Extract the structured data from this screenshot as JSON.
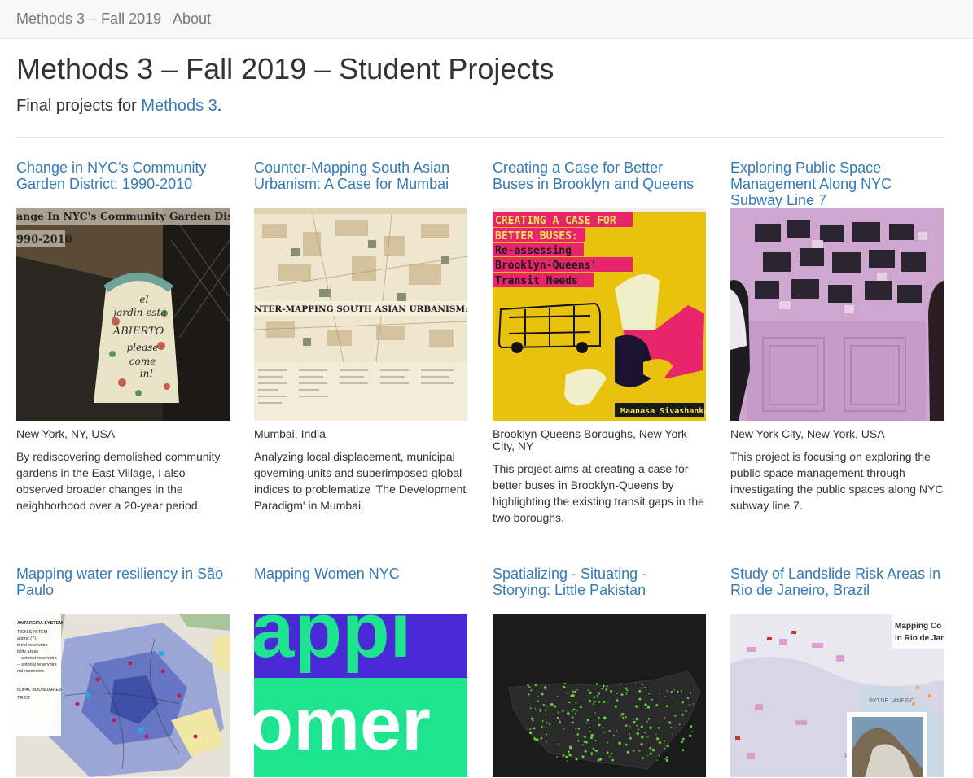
{
  "nav": {
    "brand": "Methods 3 – Fall 2019",
    "about": "About"
  },
  "header": {
    "title": "Methods 3 – Fall 2019 – Student Projects",
    "subtitle_prefix": "Final projects for ",
    "subtitle_link": "Methods 3",
    "subtitle_suffix": "."
  },
  "projects": [
    {
      "title": "Change in NYC's Community Garden District: 1990-2010",
      "location": "New York, NY, USA",
      "description": "By rediscovering demolished community gardens in the East Village, I also observed broader changes in the neighborhood over a 20-year period.",
      "thumb_text": [
        "ange In NYC's Community Garden District",
        "990-2010",
        "el",
        "jardin está",
        "ABIERTO",
        "please",
        "come",
        "in!"
      ]
    },
    {
      "title": "Counter-Mapping South Asian Urbanism: A Case for Mumbai",
      "location": "Mumbai, India",
      "description": "Analyzing local displacement, municipal governing units and superimposed global indices to problematize 'The Development Paradigm' in Mumbai.",
      "thumb_text": [
        "NTER-MAPPING SOUTH ASIAN URBANISM: A CASE FOR MUI"
      ]
    },
    {
      "title": "Creating a Case for Better Buses in Brooklyn and Queens",
      "location": "Brooklyn-Queens Boroughs, New York City, NY",
      "description": "This project aims at creating a case for better buses in Brooklyn-Queens by highlighting the existing transit gaps in the two boroughs.",
      "thumb_text": [
        "CREATING A CASE FOR",
        "BETTER BUSES:",
        "Re-assessing",
        "Brooklyn-Queens'",
        "Transit Needs",
        "Maanasa Sivashankar"
      ]
    },
    {
      "title": "Exploring Public Space Management Along NYC Subway Line 7",
      "location": "New York City, New York, USA",
      "description": "This project is focusing on exploring the public space management through investigating the public spaces along NYC subway line 7.",
      "thumb_text": []
    },
    {
      "title": "Mapping water resiliency in São Paulo",
      "location": "",
      "description": "",
      "thumb_text": [
        "ANTAREIRA SYSTEM",
        "TION SYSTEM",
        "ations (7)",
        "torial reservoirs",
        "bility areas",
        "-- setorial reservoirs",
        "-- setorial reservoirs",
        "rial reservoirs",
        "ICIPAL BOUNDARIES",
        "TRICT"
      ]
    },
    {
      "title": "Mapping Women NYC",
      "location": "",
      "description": "",
      "thumb_text": [
        "appi",
        "omer"
      ]
    },
    {
      "title": "Spatializing - Situating - Storying: Little Pakistan",
      "location": "",
      "description": "",
      "thumb_text": []
    },
    {
      "title": "Study of Landslide Risk Areas in Rio de Janeiro, Brazil",
      "location": "",
      "description": "",
      "thumb_text": [
        "Mapping Co",
        "in Rio de Jan",
        "RIO DE JANEIRO"
      ]
    }
  ],
  "colors": {
    "link": "#337ab7",
    "text": "#333333",
    "navbar_bg": "#f8f8f8",
    "nav_text": "#777777"
  }
}
